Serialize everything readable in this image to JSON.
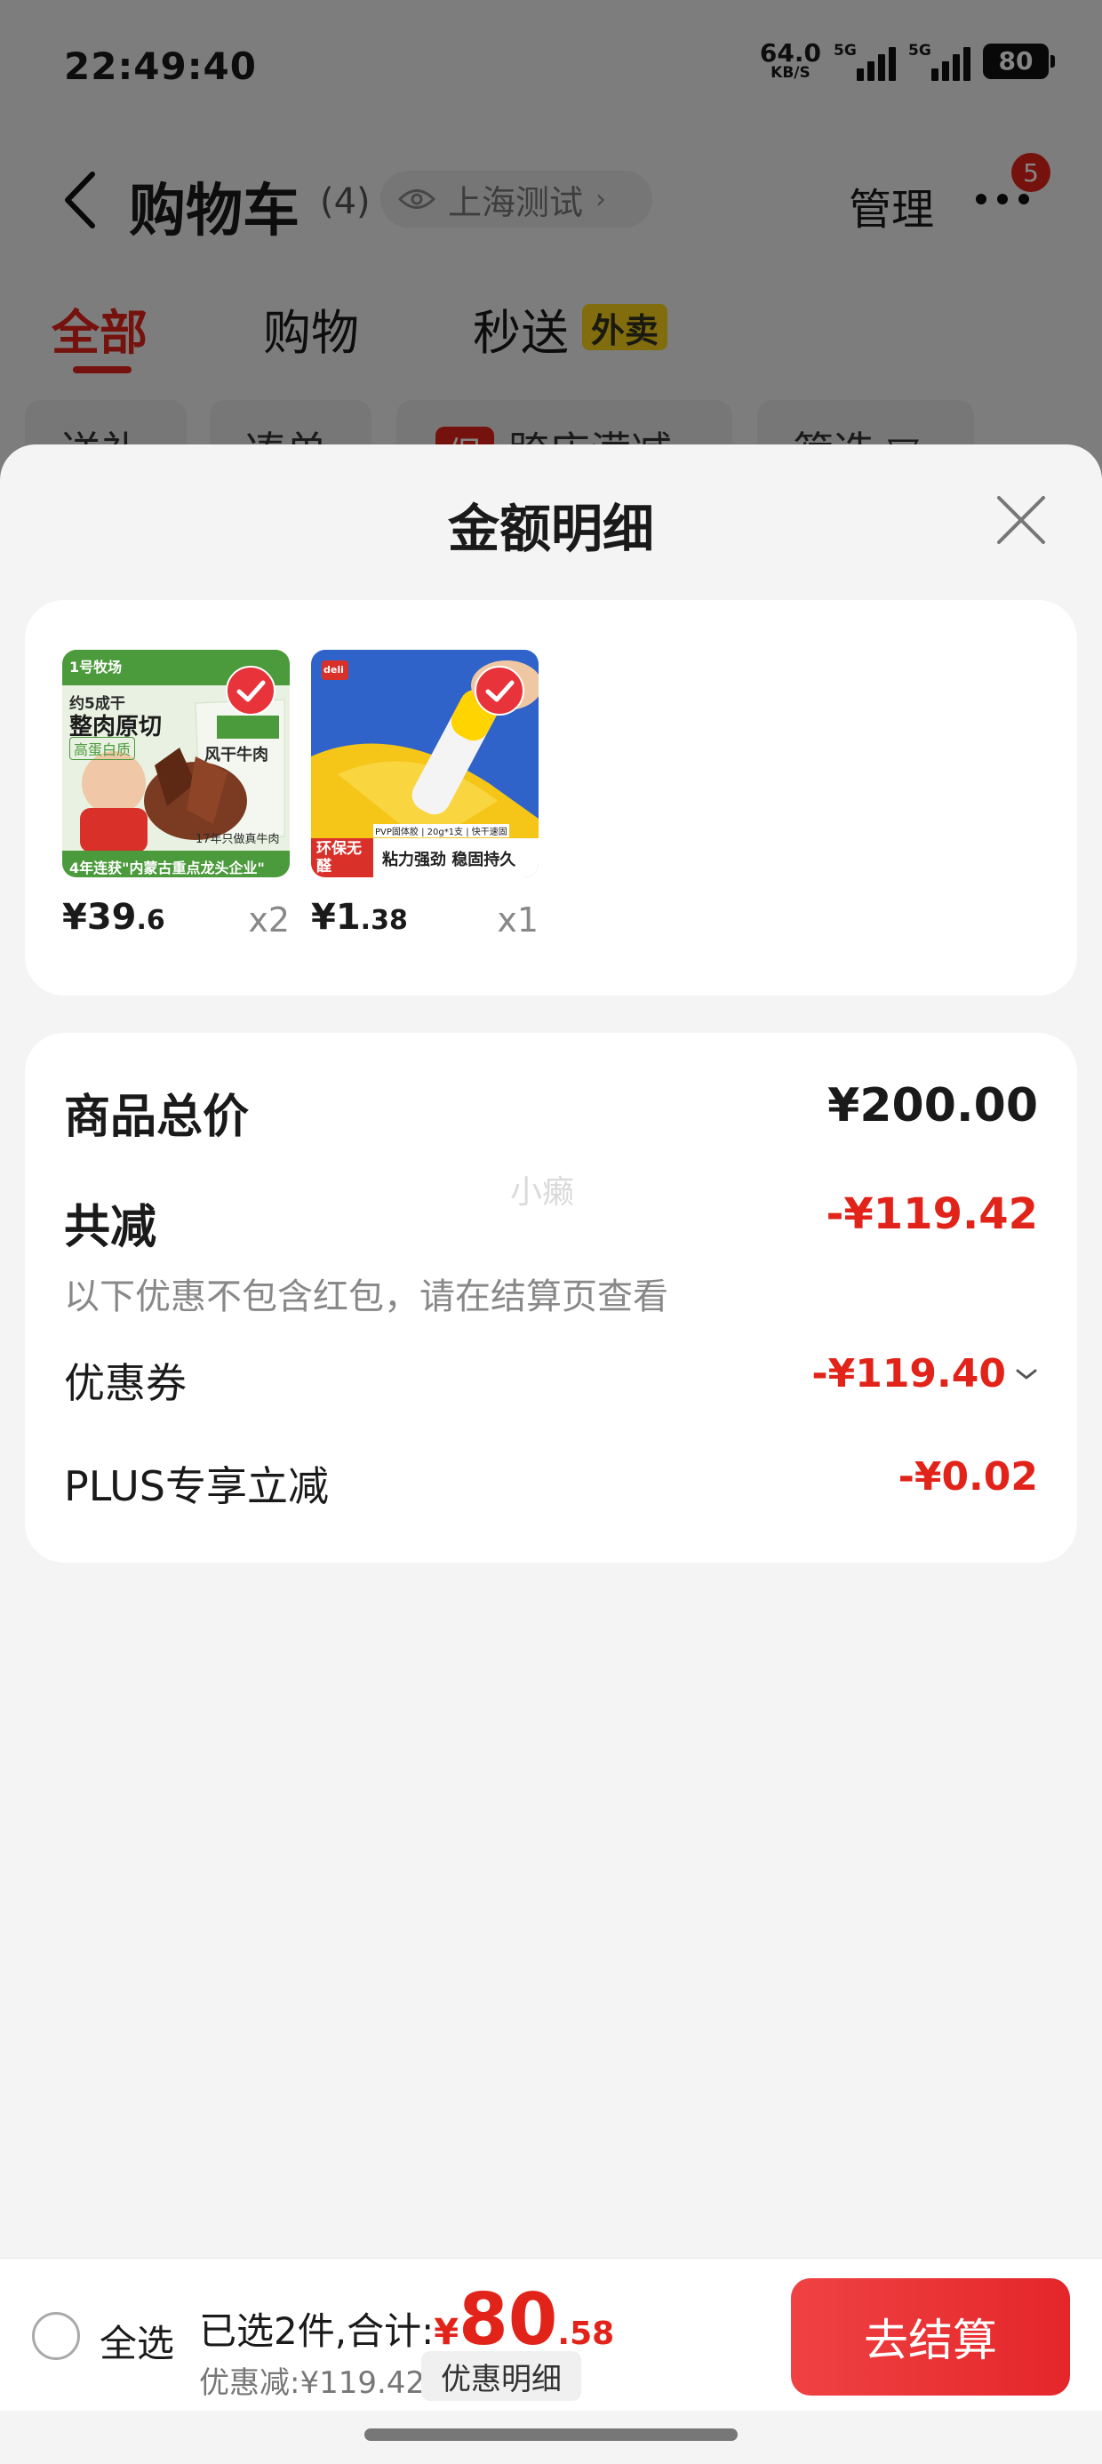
{
  "status_bar": {
    "time": "22:49:40",
    "net_speed": "64.0",
    "net_speed_unit": "KB/S",
    "signal_1": "5G",
    "signal_2": "5G",
    "battery": "80"
  },
  "navbar": {
    "title": "购物车",
    "count": "(4)",
    "location": "上海测试",
    "manage_label": "管理",
    "more_badge": "5"
  },
  "tabs": [
    {
      "label": "全部",
      "active": true
    },
    {
      "label": "购物",
      "active": false
    },
    {
      "label": "秒送",
      "active": false,
      "tag": "外卖"
    }
  ],
  "filters": [
    {
      "label": "送礼"
    },
    {
      "label": "凑单"
    },
    {
      "tag": "促",
      "label": "跨店满减"
    },
    {
      "label": "筛选"
    }
  ],
  "sheet": {
    "title": "金额明细",
    "products": [
      {
        "price_int": "¥39",
        "price_dec": ".6",
        "qty": "x2",
        "image_text": {
          "brand": "1号牧场",
          "line1": "约5成干",
          "line2": "整肉原切",
          "line3": "高蛋白质",
          "pack": "风干牛肉",
          "note": "17年只做真牛肉",
          "banner": "4年连获\"内蒙古重点龙头企业\""
        }
      },
      {
        "price_int": "¥1",
        "price_dec": ".38",
        "qty": "x1",
        "image_text": {
          "brand": "deli",
          "strip": "PVP固体胶 | 20g*1支 | 快干速固",
          "tag_green": "环保无醛",
          "slogan": "粘力强劲 稳固持久"
        }
      }
    ],
    "summary": {
      "total_label": "商品总价",
      "total_value": "¥200.00",
      "reduce_label": "共减",
      "reduce_value": "-¥119.42",
      "reduce_note": "以下优惠不包含红包，请在结算页查看",
      "coupon_label": "优惠券",
      "coupon_value": "-¥119.40",
      "plus_label": "PLUS专享立减",
      "plus_value": "-¥0.02",
      "watermark": "小癞"
    }
  },
  "bottom_bar": {
    "select_all": "全选",
    "selected_text": "已选2件,合计:",
    "currency": "¥",
    "amount_int": "80",
    "amount_dec": ".58",
    "discount_text": "优惠减:¥119.42",
    "discount_detail_label": "优惠明细",
    "checkout_label": "去结算"
  },
  "colors": {
    "accent": "#e2231a",
    "sheet_bg": "#f4f4f4",
    "card_bg": "#ffffff"
  }
}
